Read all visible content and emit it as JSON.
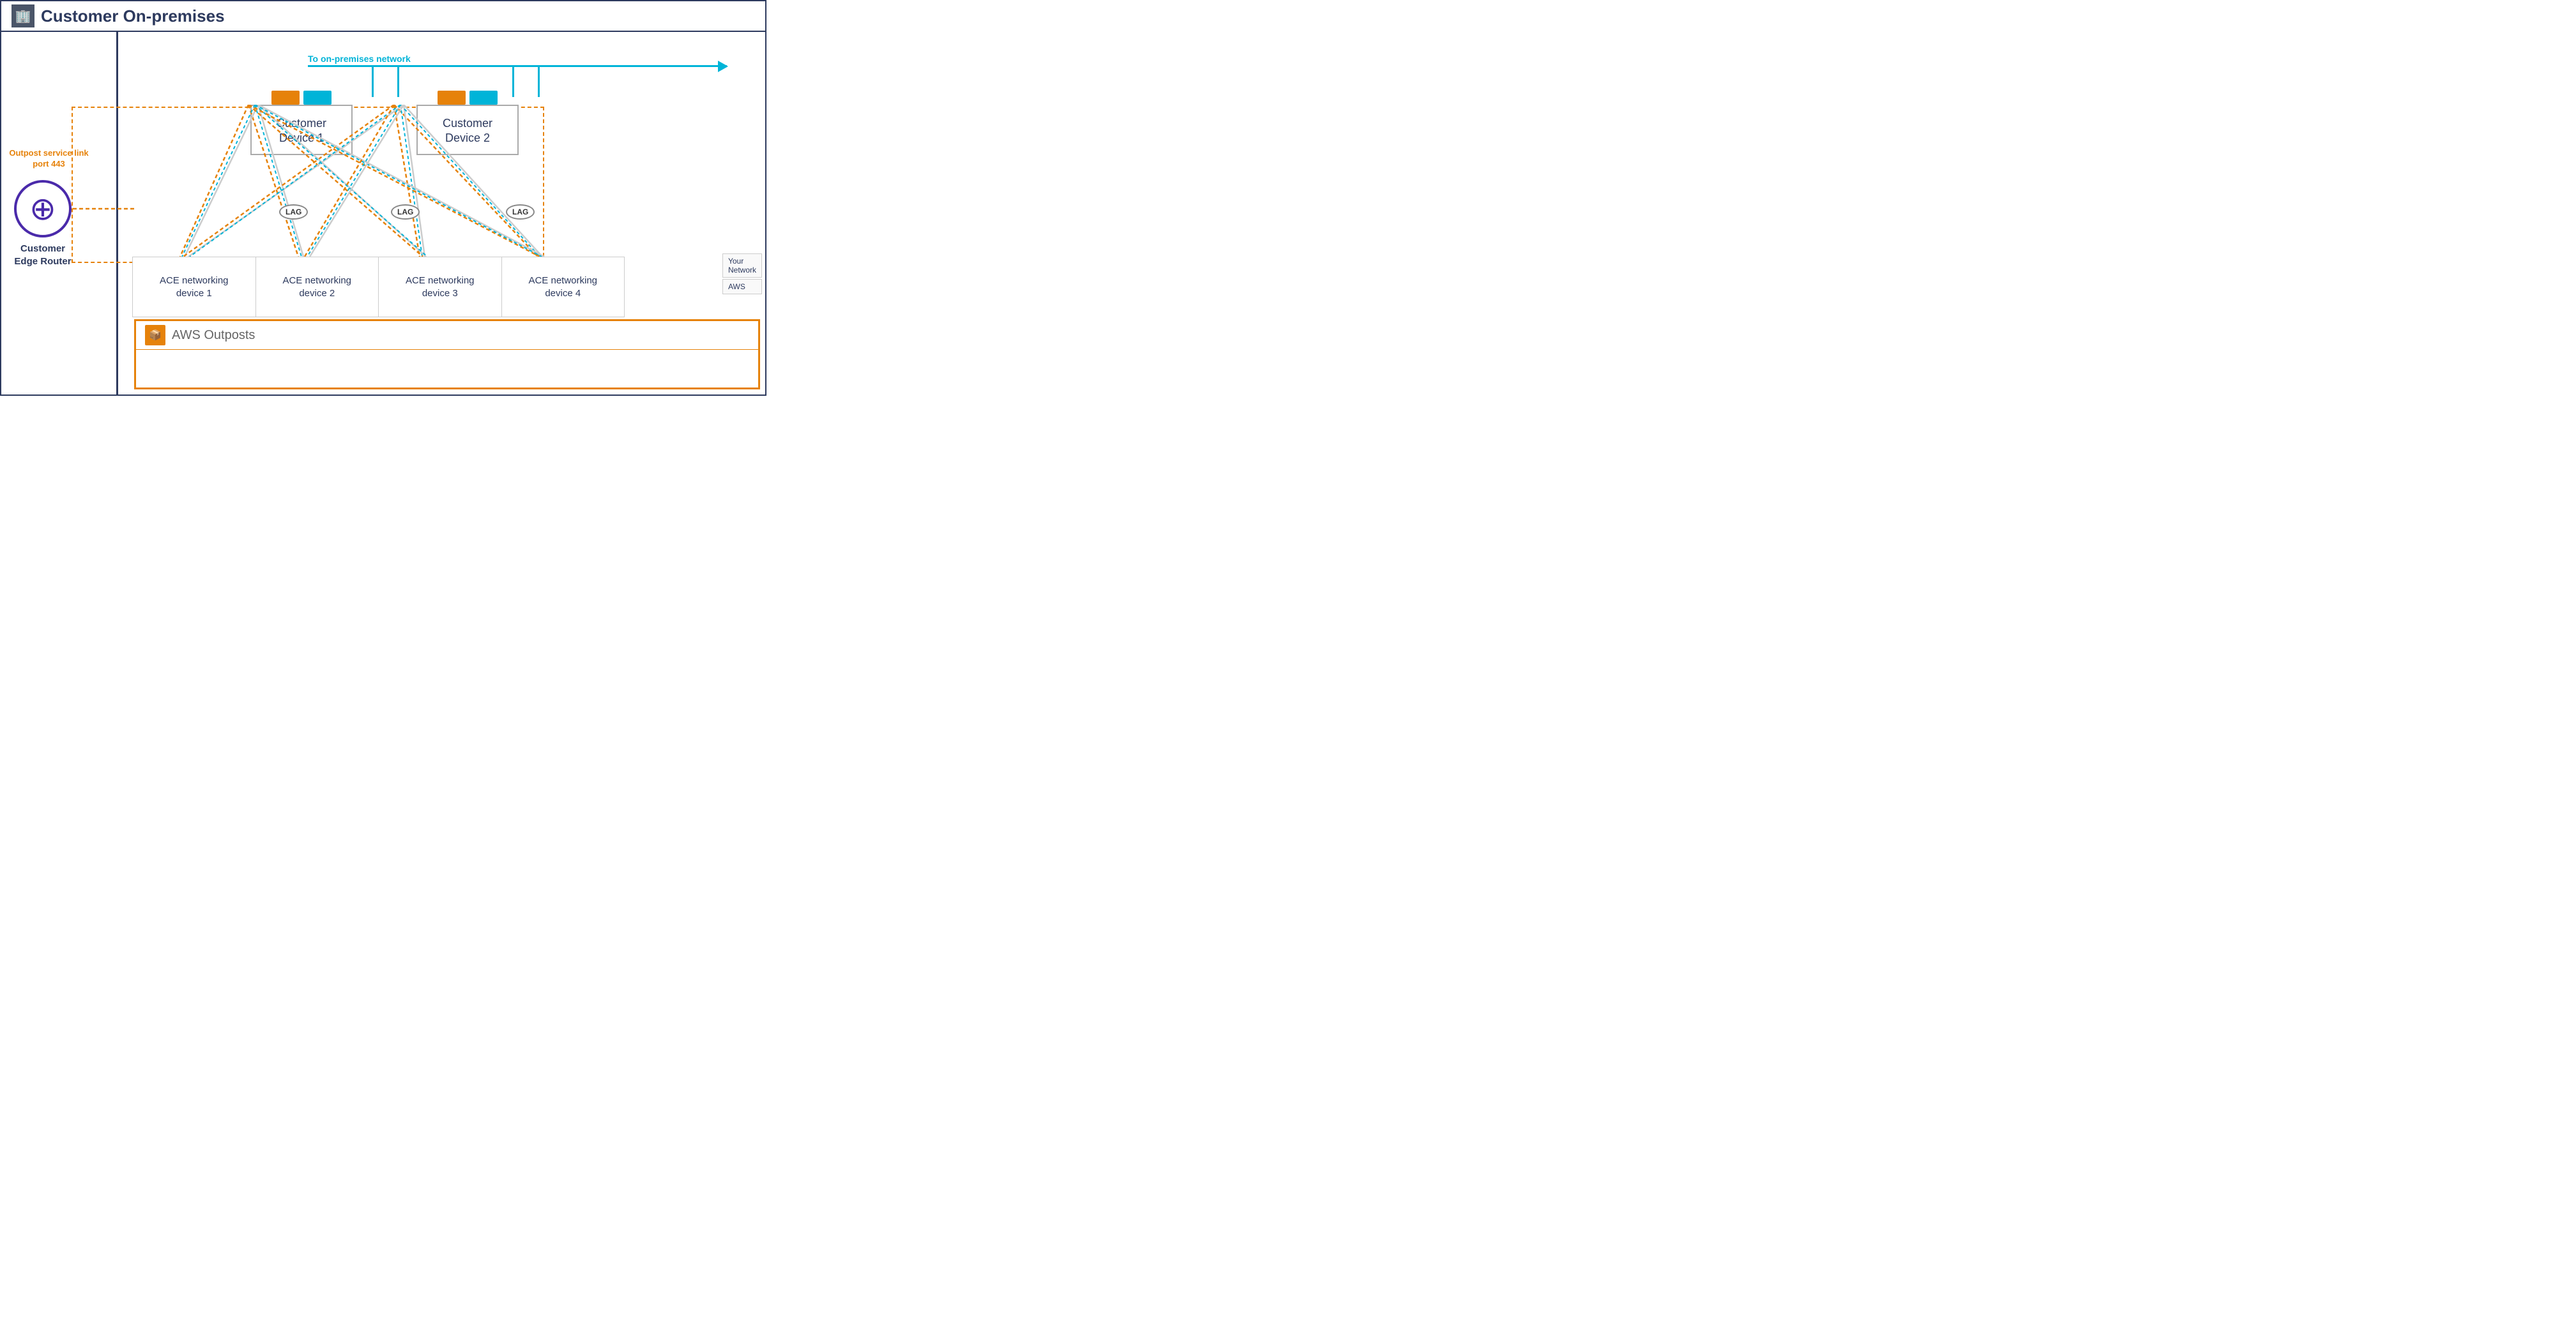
{
  "header": {
    "title": "Customer On-premises",
    "building_icon": "🏢"
  },
  "outpost_service_link": {
    "label": "Outpost service link\nport 443"
  },
  "onpremises_arrow": {
    "label": "To on-premises network"
  },
  "customer_devices": [
    {
      "id": "cd1",
      "label": "Customer\nDevice 1"
    },
    {
      "id": "cd2",
      "label": "Customer\nDevice 2"
    }
  ],
  "ace_devices": [
    {
      "id": "ace1",
      "label": "ACE networking\ndevice 1"
    },
    {
      "id": "ace2",
      "label": "ACE networking\ndevice 2"
    },
    {
      "id": "ace3",
      "label": "ACE networking\ndevice 3"
    },
    {
      "id": "ace4",
      "label": "ACE networking\ndevice 4"
    }
  ],
  "lag_labels": [
    "LAG",
    "LAG",
    "LAG"
  ],
  "right_labels": {
    "your_network": "Your\nNetwork",
    "aws": "AWS"
  },
  "router": {
    "label": "Customer\nEdge Router"
  },
  "aws_outposts": {
    "title": "AWS Outposts"
  },
  "colors": {
    "orange": "#e6820a",
    "cyan": "#00b4d8",
    "navy": "#2d3a5e",
    "purple": "#4a2aaa"
  }
}
